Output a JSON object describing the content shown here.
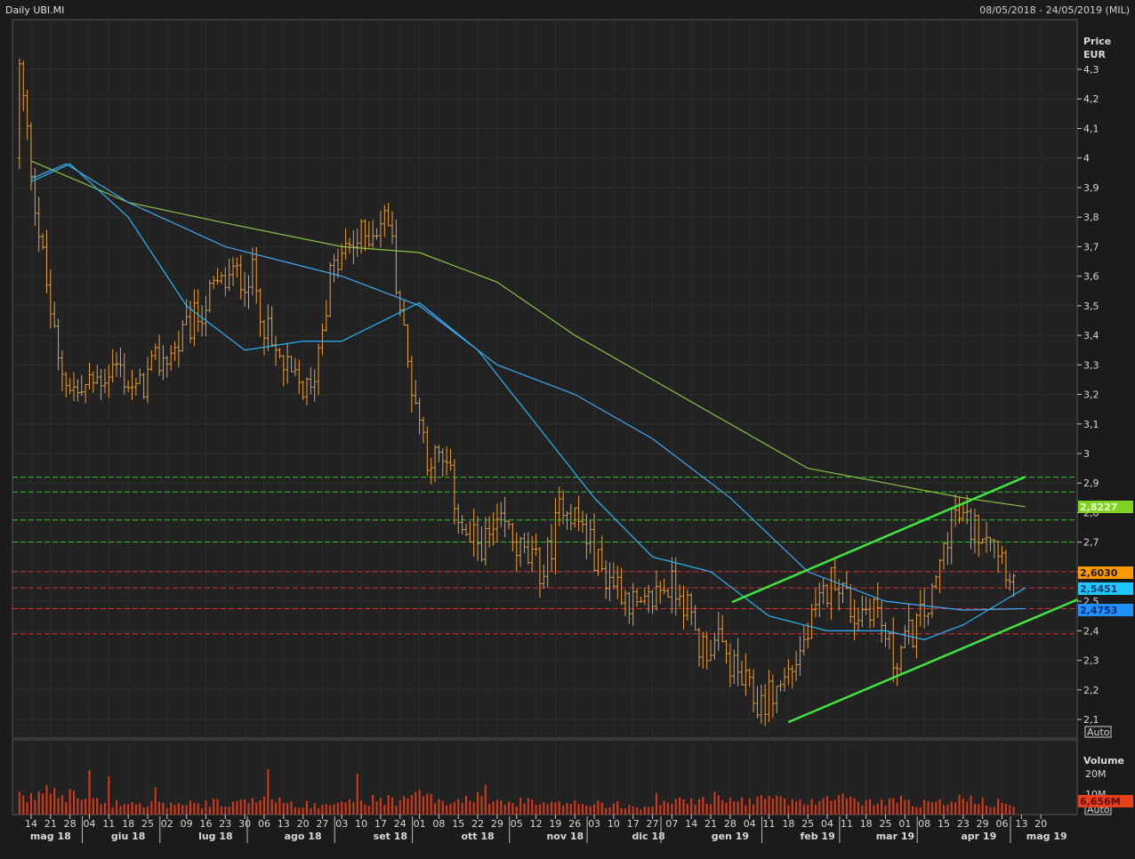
{
  "header": {
    "title": "Daily UBI.MI",
    "range": "08/05/2018 - 24/05/2019 (MIL)"
  },
  "price_axis": {
    "label_line1": "Price",
    "label_line2": "EUR",
    "auto_label": "Auto"
  },
  "volume_axis": {
    "label": "Volume",
    "ticks": [
      "20M",
      "10M"
    ],
    "auto_label": "Auto",
    "last_volume": "6,656M"
  },
  "badges": [
    {
      "text": "2,8227",
      "color": "#7ed321",
      "text_color": "#e8ffd0"
    },
    {
      "text": "2,6030",
      "color": "#ff9900",
      "text_color": "#1a1a1a"
    },
    {
      "text": "2,5451",
      "color": "#1ec8ff",
      "text_color": "#0a3a70"
    },
    {
      "text": "2,4753",
      "color": "#1e90ff",
      "text_color": "#0a2a70"
    }
  ],
  "colors": {
    "bars": "#e8a040",
    "volume": "#d83a1a",
    "ma_long": "#8cc63f",
    "ma_mid": "#3fa9f5",
    "ma_short": "#29b6f6",
    "trend": "#3ee63e",
    "support": "#d03030",
    "resist": "#30c030"
  },
  "chart_data": {
    "type": "line",
    "title": "Daily UBI.MI",
    "ylabel": "Price EUR",
    "ylim": [
      2.05,
      4.4
    ],
    "yticks": [
      "4,3",
      "4,2",
      "4,1",
      "4",
      "3,9",
      "3,8",
      "3,7",
      "3,6",
      "3,5",
      "3,4",
      "3,3",
      "3,2",
      "3,1",
      "3",
      "2,9",
      "2,8",
      "2,7",
      "2,6",
      "2,5",
      "2,4",
      "2,3",
      "2,2",
      "2,1"
    ],
    "x_week_labels": [
      "14",
      "21",
      "28",
      "04",
      "11",
      "18",
      "25",
      "02",
      "09",
      "16",
      "23",
      "30",
      "06",
      "13",
      "20",
      "27",
      "03",
      "10",
      "17",
      "24",
      "01",
      "08",
      "15",
      "22",
      "29",
      "05",
      "12",
      "19",
      "26",
      "03",
      "10",
      "17",
      "27",
      "07",
      "14",
      "21",
      "28",
      "04",
      "11",
      "18",
      "25",
      "04",
      "11",
      "18",
      "25",
      "01",
      "08",
      "15",
      "23",
      "29",
      "06",
      "13",
      "20"
    ],
    "x_month_labels": [
      {
        "label": "mag 18",
        "week": 1
      },
      {
        "label": "giu 18",
        "week": 5
      },
      {
        "label": "lug 18",
        "week": 9.5
      },
      {
        "label": "ago 18",
        "week": 14
      },
      {
        "label": "set 18",
        "week": 18.5
      },
      {
        "label": "ott 18",
        "week": 23
      },
      {
        "label": "nov 18",
        "week": 27.5
      },
      {
        "label": "dic 18",
        "week": 31.8
      },
      {
        "label": "gen 19",
        "week": 36
      },
      {
        "label": "feb 19",
        "week": 40.5
      },
      {
        "label": "mar 19",
        "week": 44.5
      },
      {
        "label": "apr 19",
        "week": 48.8
      },
      {
        "label": "mag 19",
        "week": 52.3
      }
    ],
    "month_separators": [
      3,
      7,
      11.5,
      16,
      20,
      25,
      29,
      32.8,
      38,
      42,
      46,
      50.8
    ],
    "weekly_close": [
      4.3,
      3.75,
      3.3,
      3.2,
      3.25,
      3.3,
      3.2,
      3.3,
      3.35,
      3.45,
      3.55,
      3.6,
      3.6,
      3.35,
      3.25,
      3.2,
      3.6,
      3.7,
      3.75,
      3.8,
      3.3,
      3.0,
      2.95,
      2.7,
      2.7,
      2.75,
      2.65,
      2.6,
      2.85,
      2.75,
      2.6,
      2.55,
      2.45,
      2.55,
      2.55,
      2.35,
      2.35,
      2.25,
      2.15,
      2.2,
      2.3,
      2.45,
      2.6,
      2.45,
      2.5,
      2.3,
      2.4,
      2.5,
      2.8,
      2.75,
      2.75,
      2.6
    ],
    "series": [
      {
        "name": "MA long",
        "points": [
          [
            0,
            3.99
          ],
          [
            5,
            3.85
          ],
          [
            10,
            3.78
          ],
          [
            16,
            3.7
          ],
          [
            20,
            3.68
          ],
          [
            24,
            3.58
          ],
          [
            28,
            3.4
          ],
          [
            32,
            3.25
          ],
          [
            36,
            3.1
          ],
          [
            40,
            2.95
          ],
          [
            44,
            2.9
          ],
          [
            48,
            2.85
          ],
          [
            51.2,
            2.82
          ]
        ]
      },
      {
        "name": "MA mid",
        "points": [
          [
            0,
            3.93
          ],
          [
            1.8,
            3.98
          ],
          [
            5,
            3.85
          ],
          [
            10,
            3.7
          ],
          [
            13,
            3.65
          ],
          [
            16,
            3.6
          ],
          [
            20,
            3.5
          ],
          [
            24,
            3.3
          ],
          [
            28,
            3.2
          ],
          [
            32,
            3.05
          ],
          [
            36,
            2.85
          ],
          [
            40,
            2.6
          ],
          [
            44,
            2.5
          ],
          [
            48,
            2.47
          ],
          [
            51.2,
            2.475
          ]
        ]
      },
      {
        "name": "MA short",
        "points": [
          [
            0,
            3.92
          ],
          [
            2,
            3.98
          ],
          [
            5,
            3.8
          ],
          [
            8,
            3.5
          ],
          [
            11,
            3.35
          ],
          [
            14,
            3.38
          ],
          [
            16,
            3.38
          ],
          [
            20,
            3.51
          ],
          [
            23,
            3.35
          ],
          [
            26,
            3.1
          ],
          [
            29,
            2.85
          ],
          [
            32,
            2.65
          ],
          [
            35,
            2.6
          ],
          [
            38,
            2.45
          ],
          [
            41,
            2.4
          ],
          [
            44,
            2.4
          ],
          [
            46,
            2.37
          ],
          [
            48,
            2.42
          ],
          [
            51.2,
            2.545
          ]
        ]
      }
    ],
    "resistance_levels": [
      2.92,
      2.87,
      2.775,
      2.7
    ],
    "support_levels": [
      2.6,
      2.545,
      2.475,
      2.39
    ],
    "trendlines": [
      {
        "from": [
          36.1,
          2.497
        ],
        "to": [
          51.2,
          2.921
        ]
      },
      {
        "from": [
          39.0,
          2.091
        ],
        "to": [
          53.9,
          2.506
        ]
      }
    ],
    "weekly_volume_M": [
      8,
      12,
      10,
      7,
      6,
      6,
      5,
      5,
      5,
      5,
      6,
      6,
      7,
      6,
      5,
      5,
      6,
      6,
      7,
      7,
      9,
      8,
      7,
      8,
      7,
      6,
      6,
      5,
      7,
      6,
      5,
      5,
      4,
      6,
      7,
      8,
      7,
      7,
      8,
      7,
      6,
      7,
      8,
      6,
      6,
      7,
      6,
      6,
      8,
      7,
      6,
      6
    ]
  }
}
